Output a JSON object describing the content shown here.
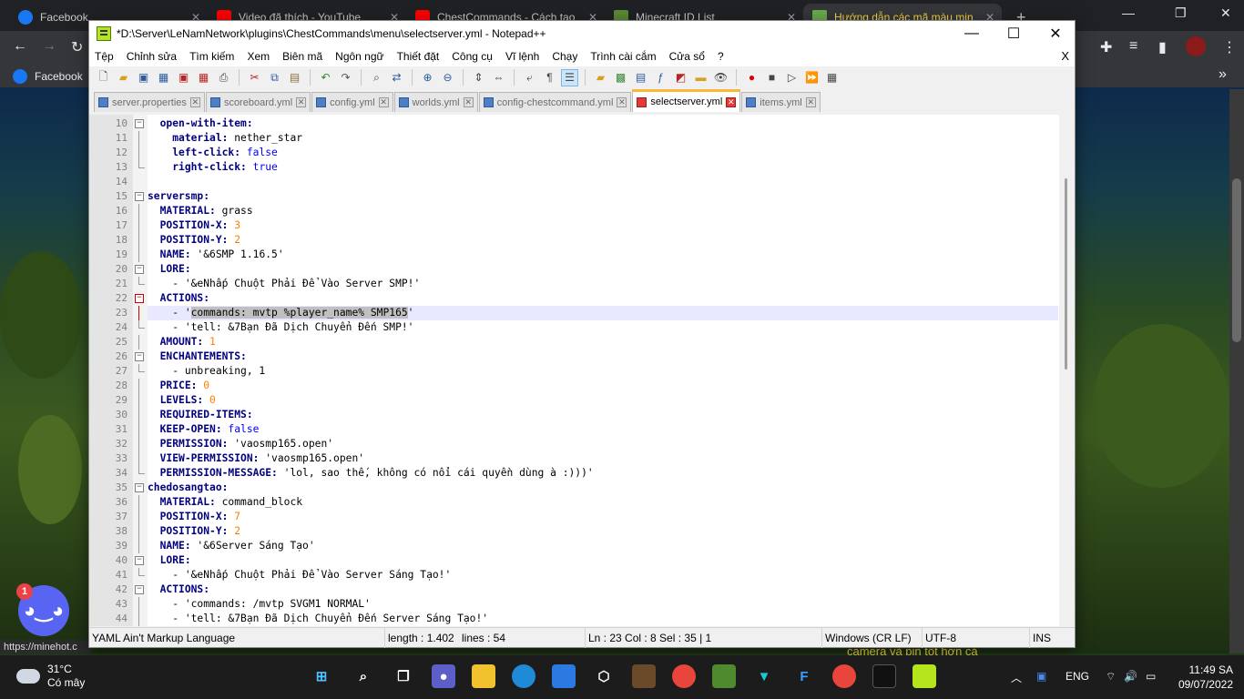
{
  "browser": {
    "tabs": [
      {
        "title": "Facebook",
        "color": "#1877f2"
      },
      {
        "title": "Video đã thích - YouTube",
        "color": "#ff0000"
      },
      {
        "title": "ChestCommands - Cách tạo",
        "color": "#ff0000"
      },
      {
        "title": "Minecraft ID List",
        "color": "#5b8a32"
      },
      {
        "title": "Hướng dẫn các mã màu min",
        "color": "#6aa84f"
      }
    ],
    "new_tab_label": "+",
    "bookmark": "Facebook",
    "status_url": "https://minehot.c",
    "page_snippet": "camera và pin tốt hơn cả"
  },
  "npp": {
    "title": "*D:\\Server\\LeNamNetwork\\plugins\\ChestCommands\\menu\\selectserver.yml - Notepad++",
    "menu": [
      "Tệp",
      "Chỉnh sửa",
      "Tìm kiếm",
      "Xem",
      "Biên mã",
      "Ngôn ngữ",
      "Thiết đặt",
      "Công cụ",
      "Vĩ lệnh",
      "Chạy",
      "Trình cài cắm",
      "Cửa sổ",
      "?"
    ],
    "menu_close": "X",
    "toolbar_icons": [
      "new-file",
      "open-file",
      "save",
      "save-all",
      "close",
      "close-all",
      "print",
      "cut",
      "copy",
      "paste",
      "undo",
      "redo",
      "find",
      "replace",
      "zoom-in",
      "zoom-out",
      "sync-v",
      "sync-h",
      "word-wrap",
      "show-all",
      "indent-guide",
      "udl",
      "doc-map",
      "function-list",
      "folder-workspace",
      "monitor",
      "record",
      "stop",
      "play",
      "run-multi",
      "save-macro"
    ],
    "file_tabs": [
      {
        "name": "server.properties",
        "active": false
      },
      {
        "name": "scoreboard.yml",
        "active": false
      },
      {
        "name": "config.yml",
        "active": false
      },
      {
        "name": "worlds.yml",
        "active": false
      },
      {
        "name": "config-chestcommand.yml",
        "active": false
      },
      {
        "name": "selectserver.yml",
        "active": true
      },
      {
        "name": "items.yml",
        "active": false
      }
    ],
    "status": {
      "language": "YAML Ain't Markup Language",
      "length": "length : 1.402",
      "lines": "lines : 54",
      "pos": "Ln : 23    Col : 8    Sel : 35 | 1",
      "eol": "Windows (CR LF)",
      "encoding": "UTF-8",
      "mode": "INS"
    },
    "lines": [
      {
        "n": "10",
        "i": "  ",
        "key": "open-with-item:",
        "val": "",
        "vt": "",
        "fold": "box"
      },
      {
        "n": "11",
        "i": "    ",
        "key": "material:",
        "val": " nether_star",
        "vt": "s",
        "fold": "line"
      },
      {
        "n": "12",
        "i": "    ",
        "key": "left-click:",
        "val": " false",
        "vt": "b",
        "fold": "line"
      },
      {
        "n": "13",
        "i": "    ",
        "key": "right-click:",
        "val": " true",
        "vt": "b",
        "fold": "end"
      },
      {
        "n": "14",
        "i": "",
        "key": "",
        "val": "",
        "vt": "",
        "fold": ""
      },
      {
        "n": "15",
        "i": "",
        "key": "serversmp:",
        "val": "",
        "vt": "",
        "fold": "box"
      },
      {
        "n": "16",
        "i": "  ",
        "key": "MATERIAL:",
        "val": " grass",
        "vt": "s",
        "fold": "line"
      },
      {
        "n": "17",
        "i": "  ",
        "key": "POSITION-X:",
        "val": " 3",
        "vt": "n",
        "fold": "line"
      },
      {
        "n": "18",
        "i": "  ",
        "key": "POSITION-Y:",
        "val": " 2",
        "vt": "n",
        "fold": "line"
      },
      {
        "n": "19",
        "i": "  ",
        "key": "NAME:",
        "val": " '&6SMP 1.16.5'",
        "vt": "s",
        "fold": "line"
      },
      {
        "n": "20",
        "i": "  ",
        "key": "LORE:",
        "val": "",
        "vt": "",
        "fold": "box"
      },
      {
        "n": "21",
        "i": "    ",
        "key": "",
        "val": "- '&eNhấp Chuột Phải Để Vào Server SMP!'",
        "vt": "s",
        "fold": "end"
      },
      {
        "n": "22",
        "i": "  ",
        "key": "ACTIONS:",
        "val": "",
        "vt": "",
        "fold": "boxred"
      },
      {
        "n": "23",
        "i": "    ",
        "key": "",
        "val": "- '",
        "sel": "commands: mvtp %player_name% SMP165",
        "tail": "'",
        "vt": "s",
        "fold": "linered",
        "cur": true
      },
      {
        "n": "24",
        "i": "    ",
        "key": "",
        "val": "- 'tell: &7Bạn Đã Dịch Chuyển Đến SMP!'",
        "vt": "s",
        "fold": "end"
      },
      {
        "n": "25",
        "i": "  ",
        "key": "AMOUNT:",
        "val": " 1",
        "vt": "n",
        "fold": "line"
      },
      {
        "n": "26",
        "i": "  ",
        "key": "ENCHANTEMENTS:",
        "val": "",
        "vt": "",
        "fold": "box"
      },
      {
        "n": "27",
        "i": "    ",
        "key": "",
        "val": "- unbreaking, 1",
        "vt": "s",
        "fold": "end"
      },
      {
        "n": "28",
        "i": "  ",
        "key": "PRICE:",
        "val": " 0",
        "vt": "n",
        "fold": "line"
      },
      {
        "n": "29",
        "i": "  ",
        "key": "LEVELS:",
        "val": " 0",
        "vt": "n",
        "fold": "line"
      },
      {
        "n": "30",
        "i": "  ",
        "key": "REQUIRED-ITEMS:",
        "val": "",
        "vt": "",
        "fold": "line"
      },
      {
        "n": "31",
        "i": "  ",
        "key": "KEEP-OPEN:",
        "val": " false",
        "vt": "b",
        "fold": "line"
      },
      {
        "n": "32",
        "i": "  ",
        "key": "PERMISSION:",
        "val": " 'vaosmp165.open'",
        "vt": "s",
        "fold": "line"
      },
      {
        "n": "33",
        "i": "  ",
        "key": "VIEW-PERMISSION:",
        "val": " 'vaosmp165.open'",
        "vt": "s",
        "fold": "line"
      },
      {
        "n": "34",
        "i": "  ",
        "key": "PERMISSION-MESSAGE:",
        "val": " 'lol, sao thế, không có nổi cái quyền dùng à :)))'",
        "vt": "s",
        "fold": "end"
      },
      {
        "n": "35",
        "i": "",
        "key": "chedosangtao:",
        "val": "",
        "vt": "",
        "fold": "box"
      },
      {
        "n": "36",
        "i": "  ",
        "key": "MATERIAL:",
        "val": " command_block",
        "vt": "s",
        "fold": "line"
      },
      {
        "n": "37",
        "i": "  ",
        "key": "POSITION-X:",
        "val": " 7",
        "vt": "n",
        "fold": "line"
      },
      {
        "n": "38",
        "i": "  ",
        "key": "POSITION-Y:",
        "val": " 2",
        "vt": "n",
        "fold": "line"
      },
      {
        "n": "39",
        "i": "  ",
        "key": "NAME:",
        "val": " '&6Server Sáng Tạo'",
        "vt": "s",
        "fold": "line"
      },
      {
        "n": "40",
        "i": "  ",
        "key": "LORE:",
        "val": "",
        "vt": "",
        "fold": "box"
      },
      {
        "n": "41",
        "i": "    ",
        "key": "",
        "val": "- '&eNhấp Chuột Phải Để Vào Server Sáng Tạo!'",
        "vt": "s",
        "fold": "end"
      },
      {
        "n": "42",
        "i": "  ",
        "key": "ACTIONS:",
        "val": "",
        "vt": "",
        "fold": "box"
      },
      {
        "n": "43",
        "i": "    ",
        "key": "",
        "val": "- 'commands: /mvtp SVGM1 NORMAL'",
        "vt": "s",
        "fold": "line"
      },
      {
        "n": "44",
        "i": "    ",
        "key": "",
        "val": "- 'tell: &7Bạn Đã Dịch Chuyển Đến Server Sáng Tạo!'",
        "vt": "s",
        "fold": "line"
      }
    ]
  },
  "discord_badge": "1",
  "taskbar": {
    "weather_temp": "31°C",
    "weather_desc": "Có mây",
    "apps": [
      "start",
      "search",
      "task-view",
      "teams-chat",
      "file-explorer",
      "edge",
      "store",
      "steam",
      "minecraft",
      "chrome",
      "minecraft-launcher",
      "vpn",
      "f-app",
      "chrome-profile",
      "terminal",
      "notepad-plus-plus"
    ],
    "lang": "ENG",
    "time": "11:49 SA",
    "date": "09/07/2022"
  }
}
